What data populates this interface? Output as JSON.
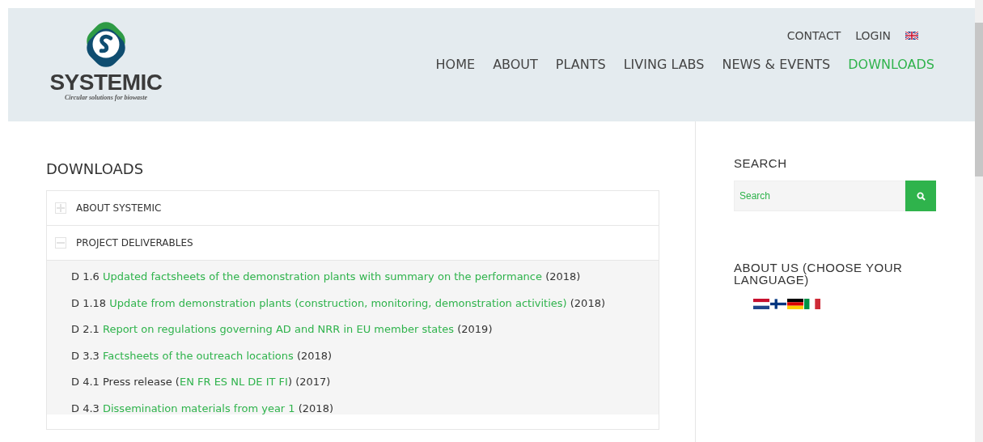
{
  "logo": {
    "name": "SYSTEMIC",
    "tagline": "Circular solutions for biowaste"
  },
  "top_links": [
    "CONTACT",
    "LOGIN"
  ],
  "language_flag": {
    "kind": "uk"
  },
  "nav": [
    {
      "label": "HOME",
      "selected": false
    },
    {
      "label": "ABOUT",
      "selected": false
    },
    {
      "label": "PLANTS",
      "selected": false
    },
    {
      "label": "LIVING LABS",
      "selected": false
    },
    {
      "label": "NEWS & EVENTS",
      "selected": false
    },
    {
      "label": "DOWNLOADS",
      "selected": true
    }
  ],
  "page_title": "DOWNLOADS",
  "sections": [
    {
      "title": "ABOUT SYSTEMIC",
      "expanded": false
    },
    {
      "title": "PROJECT DELIVERABLES",
      "expanded": true,
      "items": [
        {
          "code": "D 1.6",
          "parts": [
            {
              "text": "Updated factsheets of the demonstration plants with summary on the performance",
              "link": true
            },
            {
              "text": "(2018)",
              "link": false
            }
          ]
        },
        {
          "code": "D 1.18",
          "parts": [
            {
              "text": "Update from demonstration plants (construction, monitoring, demonstration activities)",
              "link": true
            },
            {
              "text": "(2018)",
              "link": false
            }
          ]
        },
        {
          "code": "D 2.1",
          "parts": [
            {
              "text": "Report on regulations governing AD and NRR in EU member states",
              "link": true
            },
            {
              "text": "(2019)",
              "link": false
            }
          ]
        },
        {
          "code": "D 3.3",
          "parts": [
            {
              "text": "Factsheets of the outreach locations",
              "link": true
            },
            {
              "text": "(2018)",
              "link": false
            }
          ]
        },
        {
          "code": "D 4.1",
          "parts": [
            {
              "text": "Press release (",
              "link": false
            },
            {
              "text": "EN FR ES NL DE IT FI",
              "link": true
            },
            {
              "text": ") (2017)",
              "link": false
            }
          ]
        },
        {
          "code": "D 4.3",
          "parts": [
            {
              "text": "Dissemination materials from year 1",
              "link": true
            },
            {
              "text": "(2018)",
              "link": false
            }
          ]
        }
      ]
    }
  ],
  "sidebar": {
    "search_title": "SEARCH",
    "search": {
      "placeholder": "Search"
    },
    "about_title": "ABOUT US (CHOOSE YOUR LANGUAGE)",
    "flags": [
      {
        "kind": "nl"
      },
      {
        "kind": "fi"
      },
      {
        "kind": "de"
      },
      {
        "kind": "it"
      }
    ]
  }
}
